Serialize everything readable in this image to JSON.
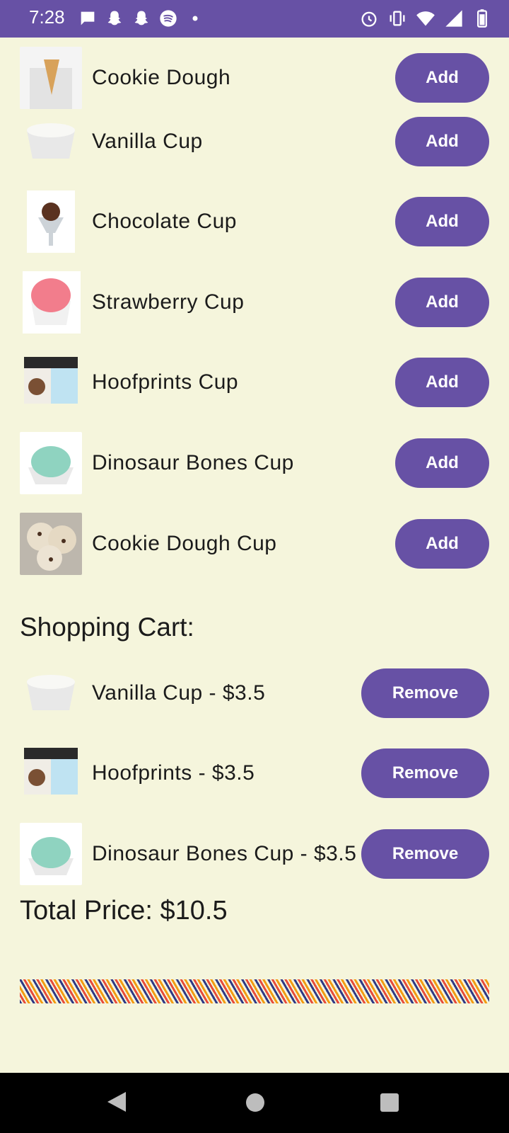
{
  "status": {
    "time": "7:28"
  },
  "menu": {
    "items": [
      {
        "label": "Cookie Dough",
        "button": "Add",
        "icon": "cone-jar-image"
      },
      {
        "label": "Vanilla Cup",
        "button": "Add",
        "icon": "vanilla-cup-image"
      },
      {
        "label": "Chocolate Cup",
        "button": "Add",
        "icon": "chocolate-sundae-image"
      },
      {
        "label": "Strawberry Cup",
        "button": "Add",
        "icon": "strawberry-cup-image"
      },
      {
        "label": "Hoofprints Cup",
        "button": "Add",
        "icon": "hoofprints-carton-image"
      },
      {
        "label": "Dinosaur Bones Cup",
        "button": "Add",
        "icon": "dinosaur-bowl-image"
      },
      {
        "label": "Cookie Dough Cup",
        "button": "Add",
        "icon": "cookie-dough-scoops-image"
      }
    ]
  },
  "cart": {
    "title": "Shopping Cart:",
    "items": [
      {
        "label": "Vanilla Cup - $3.5",
        "button": "Remove",
        "icon": "vanilla-cup-image"
      },
      {
        "label": "Hoofprints - $3.5",
        "button": "Remove",
        "icon": "hoofprints-carton-image"
      },
      {
        "label": "Dinosaur Bones Cup - $3.5",
        "button": "Remove",
        "icon": "dinosaur-bowl-image"
      }
    ],
    "total": "Total Price: $10.5"
  },
  "colors": {
    "primary": "#6751A5",
    "background": "#F5F5DC",
    "nav": "#000000"
  }
}
